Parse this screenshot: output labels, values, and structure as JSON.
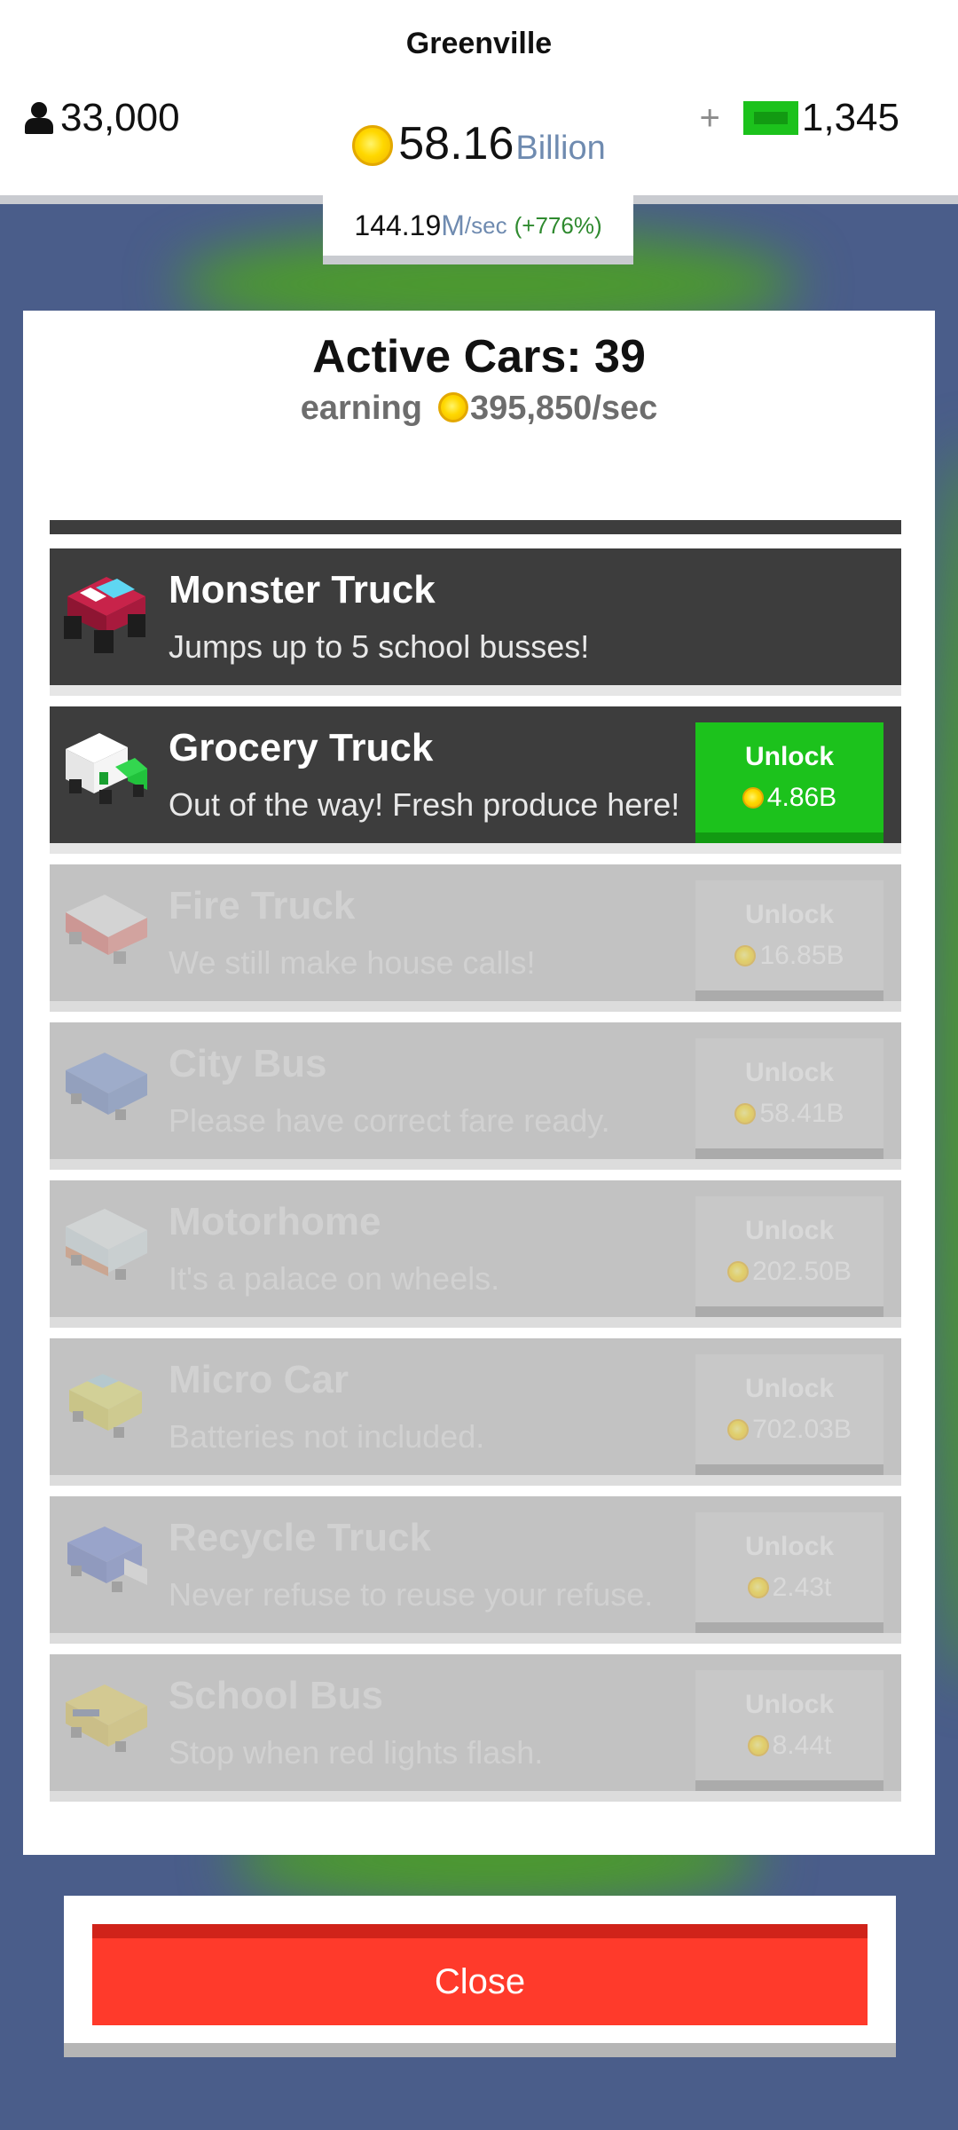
{
  "header": {
    "city_name": "Greenville",
    "population": "33,000",
    "coins_amount": "58.16",
    "coins_unit": "Billion",
    "cash_plus": "+",
    "cash": "1,345",
    "rate_value": "144.19",
    "rate_unit": "M",
    "rate_suffix": "/sec",
    "rate_change": "(+776%)"
  },
  "panel": {
    "title": "Active Cars: 39",
    "earning_label": "earning",
    "earning_value": "395,850/sec"
  },
  "vehicles": [
    {
      "name": "Monster Truck",
      "desc": "Jumps up to 5 school busses!",
      "state": "owned",
      "icon": "monster-truck-icon"
    },
    {
      "name": "Grocery Truck",
      "desc": "Out of the way! Fresh produce here!",
      "state": "available",
      "unlock_label": "Unlock",
      "price": "4.86B",
      "icon": "grocery-truck-icon"
    },
    {
      "name": "Fire Truck",
      "desc": "We still make house calls!",
      "state": "locked",
      "unlock_label": "Unlock",
      "price": "16.85B",
      "icon": "fire-truck-icon"
    },
    {
      "name": "City Bus",
      "desc": "Please have correct fare ready.",
      "state": "locked",
      "unlock_label": "Unlock",
      "price": "58.41B",
      "icon": "city-bus-icon"
    },
    {
      "name": "Motorhome",
      "desc": "It's a palace on wheels.",
      "state": "locked",
      "unlock_label": "Unlock",
      "price": "202.50B",
      "icon": "motorhome-icon"
    },
    {
      "name": "Micro Car",
      "desc": "Batteries not included.",
      "state": "locked",
      "unlock_label": "Unlock",
      "price": "702.03B",
      "icon": "micro-car-icon"
    },
    {
      "name": "Recycle Truck",
      "desc": "Never refuse to reuse your refuse.",
      "state": "locked",
      "unlock_label": "Unlock",
      "price": "2.43t",
      "icon": "recycle-truck-icon"
    },
    {
      "name": "School Bus",
      "desc": "Stop when red lights flash.",
      "state": "locked",
      "unlock_label": "Unlock",
      "price": "8.44t",
      "icon": "school-bus-icon"
    }
  ],
  "close_label": "Close",
  "colors": {
    "background": "#4a5d8a",
    "unlock_green": "#1cc21c",
    "close_red": "#ff3a2b",
    "row_dark": "#3d3d3d",
    "row_locked": "#c2c2c2"
  }
}
